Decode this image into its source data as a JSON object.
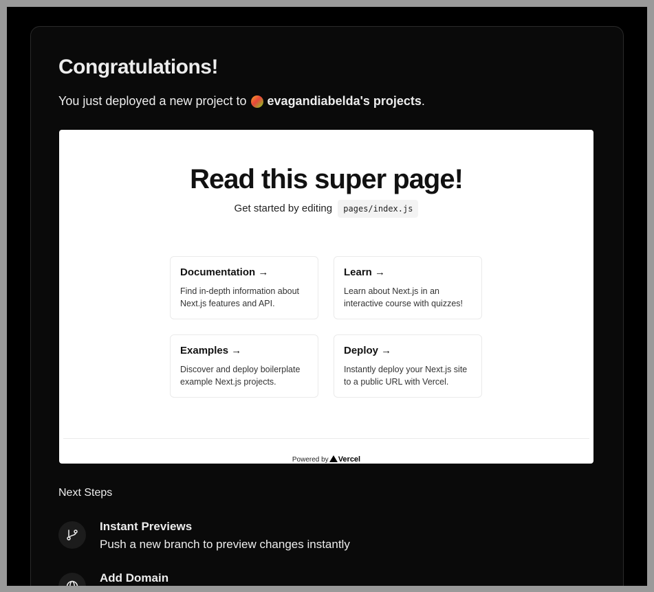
{
  "header": {
    "title": "Congratulations!",
    "subtitle_prefix": "You just deployed a new project to",
    "team_name": "evagandiabelda's projects",
    "subtitle_suffix": "."
  },
  "preview": {
    "title": "Read this super page!",
    "description_prefix": "Get started by editing",
    "code": "pages/index.js",
    "cards": [
      {
        "title": "Documentation →",
        "text": "Find in-depth information about Next.js features and API."
      },
      {
        "title": "Learn →",
        "text": "Learn about Next.js in an interactive course with quizzes!"
      },
      {
        "title": "Examples →",
        "text": "Discover and deploy boilerplate example Next.js projects."
      },
      {
        "title": "Deploy →",
        "text": "Instantly deploy your Next.js site to a public URL with Vercel."
      }
    ],
    "footer_powered": "Powered by",
    "footer_brand": "Vercel"
  },
  "next_steps": {
    "heading": "Next Steps",
    "items": [
      {
        "title": "Instant Previews",
        "description": "Push a new branch to preview changes instantly",
        "icon": "git-branch-icon"
      },
      {
        "title": "Add Domain",
        "description": "",
        "icon": "globe-icon"
      }
    ]
  },
  "colors": {
    "background": "#000000",
    "card": "#0a0a0a",
    "text": "#ededed",
    "preview_bg": "#ffffff"
  }
}
